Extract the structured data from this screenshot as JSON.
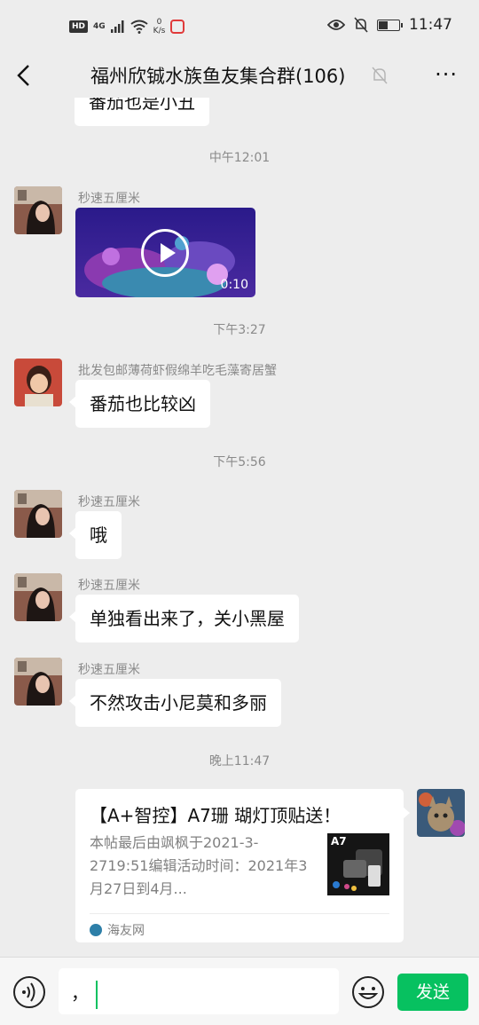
{
  "statusbar": {
    "hd": "HD",
    "network": "4G",
    "speed_value": "0",
    "speed_unit": "K/s",
    "time": "11:47",
    "battery_level": 0.45
  },
  "header": {
    "title": "福州欣铖水族鱼友集合群(106)",
    "more_label": "···"
  },
  "chat": {
    "partial_bubble": "番茄也是小丑",
    "messages": [
      {
        "type": "time",
        "text": "中午12:01"
      },
      {
        "type": "video",
        "sender": "秒速五厘米",
        "duration": "0:10"
      },
      {
        "type": "time",
        "text": "下午3:27"
      },
      {
        "type": "text",
        "sender": "批发包邮薄荷虾假绵羊吃毛藻寄居蟹",
        "text": "番茄也比较凶"
      },
      {
        "type": "time",
        "text": "下午5:56"
      },
      {
        "type": "text",
        "sender": "秒速五厘米",
        "text": "哦"
      },
      {
        "type": "text",
        "sender": "秒速五厘米",
        "text": "单独看出来了，关小黑屋"
      },
      {
        "type": "text",
        "sender": "秒速五厘米",
        "text": "不然攻击小尼莫和多丽"
      },
      {
        "type": "time",
        "text": "晚上11:47"
      },
      {
        "type": "link",
        "title": "【A+智控】A7珊 瑚灯顶贴送！",
        "desc": "本帖最后由飒枫于2021-3-2719:51编辑活动时间：2021年3月27日到4月...",
        "thumb_label": "A7",
        "source": "海友网"
      }
    ]
  },
  "inputbar": {
    "text": "，",
    "send_label": "发送"
  },
  "colors": {
    "background": "#ededed",
    "accent": "#07c160",
    "bubble": "#ffffff"
  }
}
